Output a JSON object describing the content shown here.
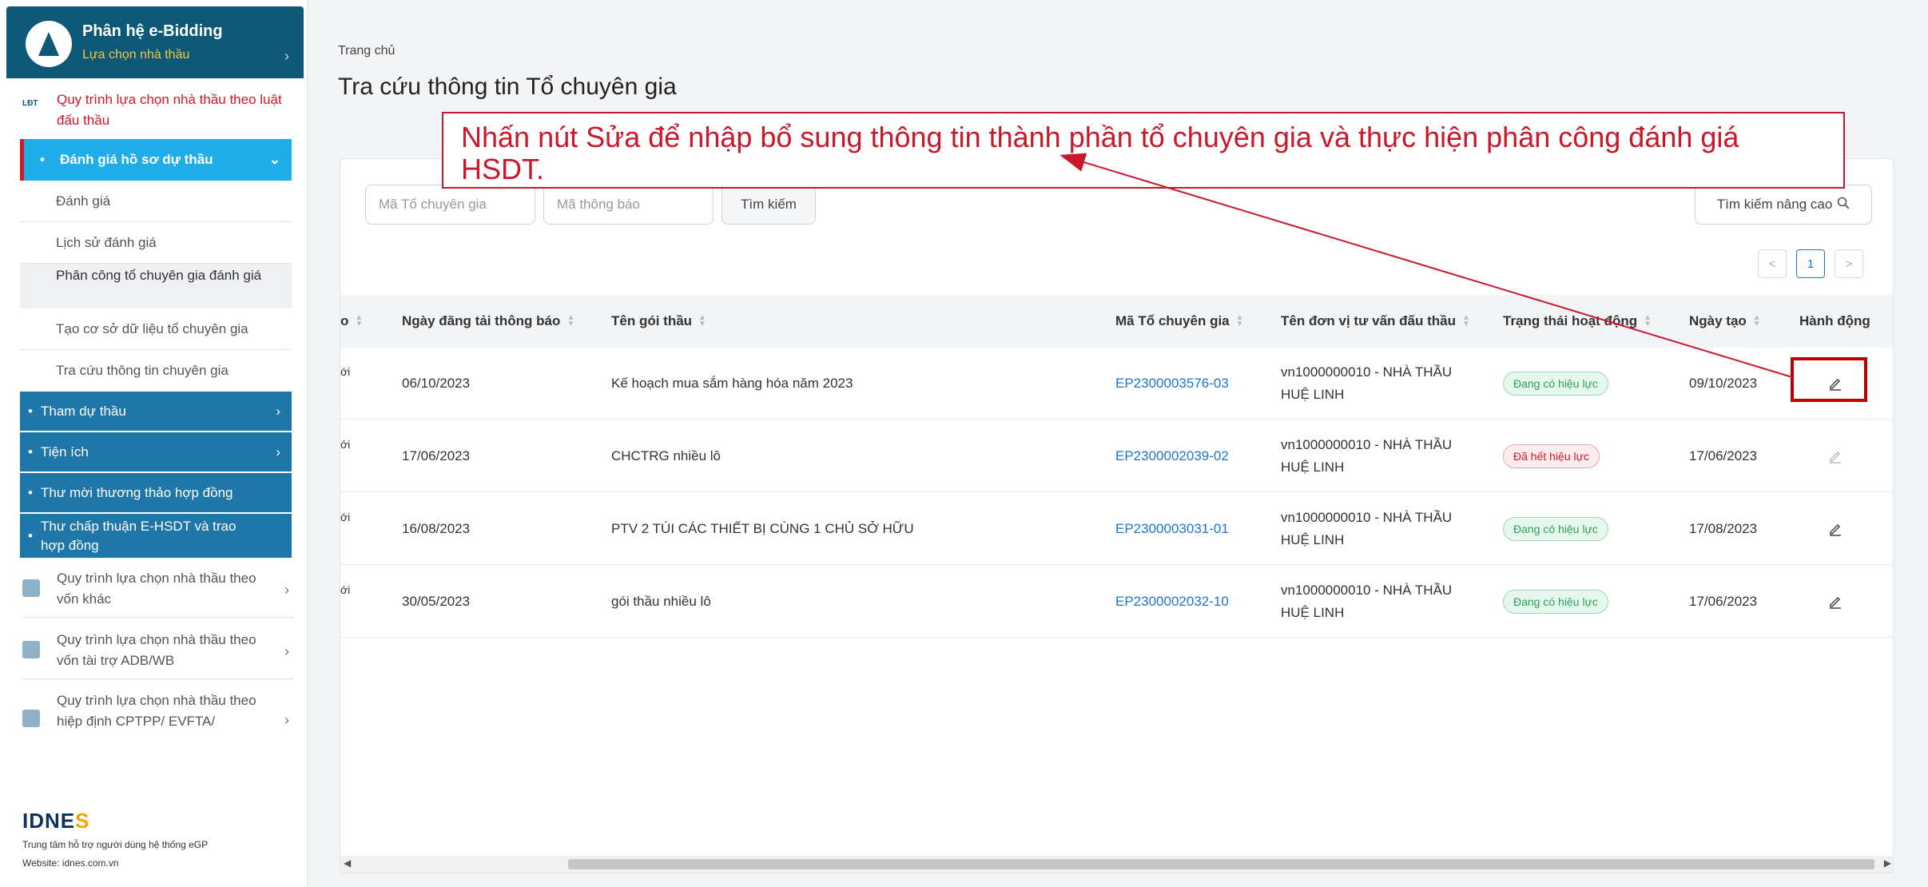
{
  "sidebar": {
    "header_title": "Phân hệ e-Bidding",
    "header_sub": "Lựa chọn nhà thầu",
    "red_menu": "Quy trình lựa chọn nhà thầu theo luật đấu thầu",
    "red_menu_icon_text": "LĐT",
    "section_eval": "Đánh giá hồ sơ dự thầu",
    "items": [
      "Đánh giá",
      "Lịch sử đánh giá",
      "Phân công tổ chuyên gia đánh giá",
      "Tạo cơ sở dữ liệu tổ chuyên gia",
      "Tra cứu thông tin chuyên gia"
    ],
    "blue_items": [
      "Tham dự thầu",
      "Tiện ích",
      "Thư mời thương thảo hợp đồng",
      "Thư chấp thuận E-HSDT và trao hợp đồng"
    ],
    "other_menus": [
      "Quy trình lựa chọn nhà thầu theo vốn khác",
      "Quy trình lựa chọn nhà thầu theo vốn tài trợ ADB/WB",
      "Quy trình lựa chọn nhà thầu theo hiệp định CPTPP/ EVFTA/"
    ],
    "footer_logo_a": "IDNE",
    "footer_logo_b": "S",
    "footer_line1": "Trung tâm hỗ trợ người dùng hệ thống eGP",
    "footer_line2": "Website: idnes.com.vn"
  },
  "breadcrumb": "Trang chủ",
  "page_title": "Tra cứu thông tin Tổ chuyên gia",
  "search": {
    "placeholder_group": "Mã Tổ chuyên gia",
    "placeholder_notice": "Mã thông báo",
    "search_button": "Tìm kiếm",
    "advanced_button": "Tìm kiếm nâng cao"
  },
  "pagination": {
    "prev": "<",
    "current": "1",
    "next": ">"
  },
  "table": {
    "partial_col": "o",
    "columns": [
      "Ngày đăng tải thông báo",
      "Tên gói thầu",
      "Mã Tổ chuyên gia",
      "Tên đơn vị tư vấn đấu thầu",
      "Trạng thái hoạt động",
      "Ngày tạo",
      "Hành động"
    ],
    "rows": [
      {
        "partial": "ới",
        "date_posted": "06/10/2023",
        "package": "Kế hoạch mua sắm hàng hóa năm 2023",
        "code": "EP2300003576-03",
        "unit_l1": "vn1000000010 - NHÀ THẦU",
        "unit_l2": "HUỆ LINH",
        "status": "Đang có hiệu lực",
        "created": "09/10/2023"
      },
      {
        "partial": "ới",
        "date_posted": "17/06/2023",
        "package": "CHCTRG nhiều lô",
        "code": "EP2300002039-02",
        "unit_l1": "vn1000000010 - NHÀ THẦU",
        "unit_l2": "HUỆ LINH",
        "status": "Đã hết hiệu lực",
        "created": "17/06/2023"
      },
      {
        "partial": "ới",
        "date_posted": "16/08/2023",
        "package": "PTV 2 TÚI CÁC THIẾT BỊ CÙNG 1 CHỦ SỞ HỮU",
        "code": "EP2300003031-01",
        "unit_l1": "vn1000000010 - NHÀ THẦU",
        "unit_l2": "HUỆ LINH",
        "status": "Đang có hiệu lực",
        "created": "17/08/2023"
      },
      {
        "partial": "ới",
        "date_posted": "30/05/2023",
        "package": "gói thầu nhiều lô",
        "code": "EP2300002032-10",
        "unit_l1": "vn1000000010 - NHÀ THẦU",
        "unit_l2": "HUỆ LINH",
        "status": "Đang có hiệu lực",
        "created": "17/06/2023"
      }
    ]
  },
  "callout_text": "Nhấn nút Sửa để nhập bổ sung thông tin thành phần tổ chuyên gia và thực hiện phân công đánh giá HSDT.",
  "colors": {
    "accent": "#0c5876",
    "highlight": "#c8192c",
    "link": "#1f76d2"
  }
}
